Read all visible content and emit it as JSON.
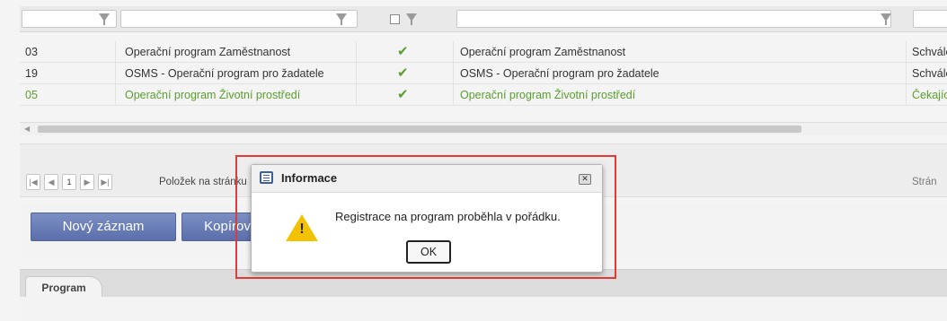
{
  "grid": {
    "rows": [
      {
        "code": "03",
        "name": "Operační program Zaměstnanost",
        "checked": "✔",
        "full_name": "Operační program Zaměstnanost",
        "status": "Schvále"
      },
      {
        "code": "19",
        "name": "OSMS - Operační program pro žadatele",
        "checked": "✔",
        "full_name": "OSMS - Operační program pro žadatele",
        "status": "Schvále"
      },
      {
        "code": "05",
        "name": "Operační program Životní prostředí",
        "checked": "✔",
        "full_name": "Operační program Životní prostředí",
        "status": "Čekající"
      }
    ]
  },
  "pager": {
    "first": "|◀",
    "prev": "◀",
    "page": "1",
    "next": "▶",
    "last": "▶|",
    "items_label": "Položek na stránku",
    "right_label": "Strán"
  },
  "buttons": {
    "new_record": "Nový záznam",
    "copy": "Kopírov"
  },
  "tabs": {
    "program": "Program"
  },
  "dialog": {
    "title": "Informace",
    "close": "✕",
    "warning_mark": "!",
    "message": "Registrace na program proběhla v pořádku.",
    "ok": "OK"
  },
  "colors": {
    "selected_row_text": "#5a9e2f",
    "button": "#6476b3",
    "highlight_frame": "#e53935"
  }
}
